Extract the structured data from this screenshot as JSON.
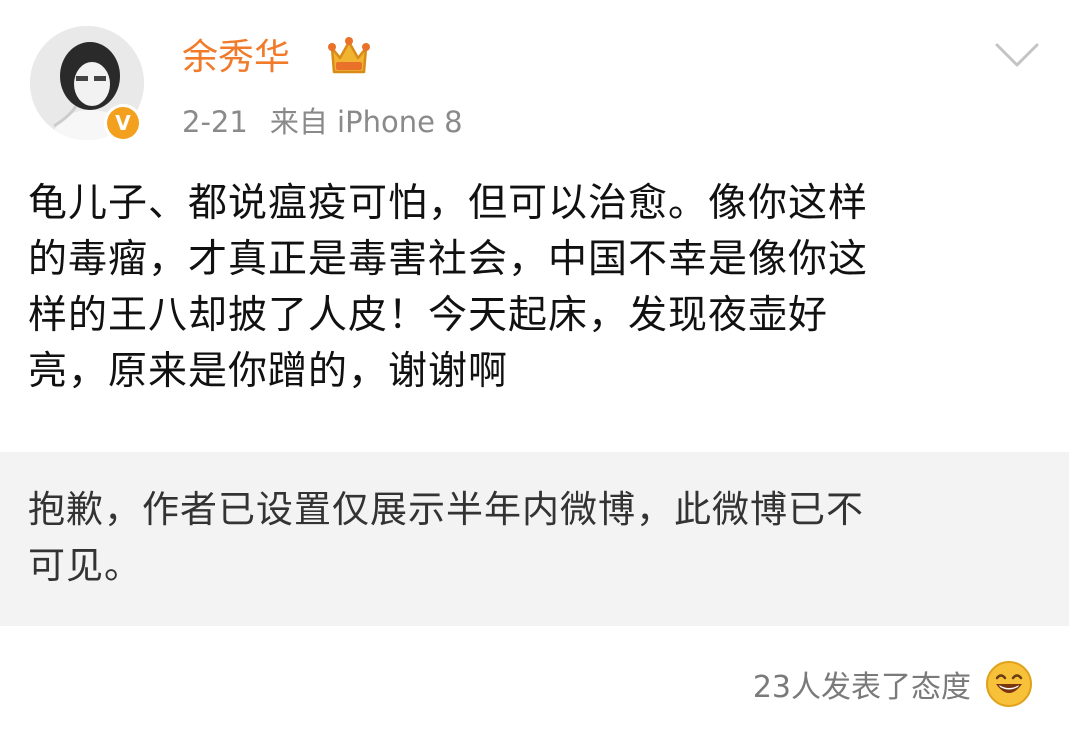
{
  "user": {
    "name": "余秀华",
    "crown_icon": "crown-icon",
    "verified_icon": "verified-v-icon",
    "verified_mark": "V"
  },
  "post": {
    "time": "2-21",
    "source": "来自 iPhone 8",
    "text": "龟儿子、都说瘟疫可怕，但可以治愈。像你这样\n的毒瘤，才真正是毒害社会，中国不幸是像你这\n样的王八却披了人皮！今天起床，发现夜壶好\n亮，原来是你蹭的，谢谢啊"
  },
  "retweet": {
    "notice": "抱歉，作者已设置仅展示半年内微博，此微博已不\n可见。"
  },
  "footer": {
    "reactions_label": "23人发表了态度",
    "reaction_icon": "laughing-face-icon"
  },
  "colors": {
    "username": "#f17b2b",
    "meta": "#8a8a8a",
    "badge": "#f3a01f",
    "retweet_bg": "#f3f3f3"
  }
}
